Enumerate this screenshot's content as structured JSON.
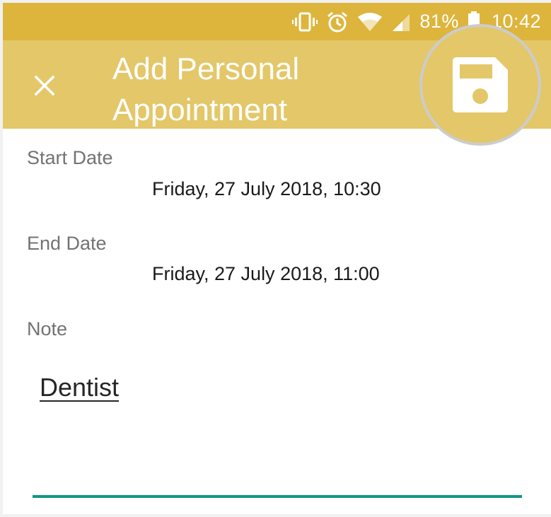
{
  "status_bar": {
    "battery": "81%",
    "time": "10:42",
    "icons": [
      "vibrate-icon",
      "alarm-icon",
      "wifi-icon",
      "signal-icon",
      "battery-icon"
    ]
  },
  "app_bar": {
    "title": "Add Personal Appointment",
    "close_icon": "close-icon",
    "save_icon": "save-icon"
  },
  "form": {
    "start_date": {
      "label": "Start Date",
      "value": "Friday, 27 July 2018, 10:30"
    },
    "end_date": {
      "label": "End Date",
      "value": "Friday, 27 July 2018, 11:00"
    },
    "note": {
      "label": "Note",
      "value": "Dentist"
    }
  },
  "colors": {
    "status_bar": "#ddb53c",
    "app_bar": "#e3c769",
    "accent": "#129688",
    "label": "#737373",
    "value": "#1a1a1a"
  }
}
